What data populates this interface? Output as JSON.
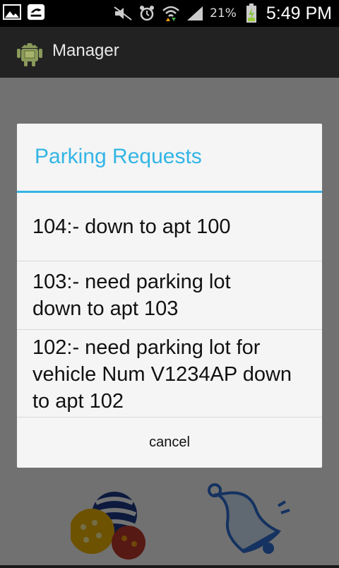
{
  "status_bar": {
    "icons_left": [
      "gallery-icon",
      "notification-icon"
    ],
    "icons_right": [
      "mute-icon",
      "alarm-icon",
      "wifi-icon",
      "signal-icon",
      "battery-icon"
    ],
    "battery": "21%",
    "time": "5:49 PM"
  },
  "action_bar": {
    "title": "Manager",
    "logo": "android-icon"
  },
  "dialog": {
    "title": "Parking Requests",
    "accent_color": "#33b5e5",
    "items": [
      "104:- down to apt 100",
      "103:- need parking lot down to apt 103",
      "102:- need parking lot for vehicle Num V1234AP down to apt 102"
    ],
    "cancel_label": "cancel"
  }
}
